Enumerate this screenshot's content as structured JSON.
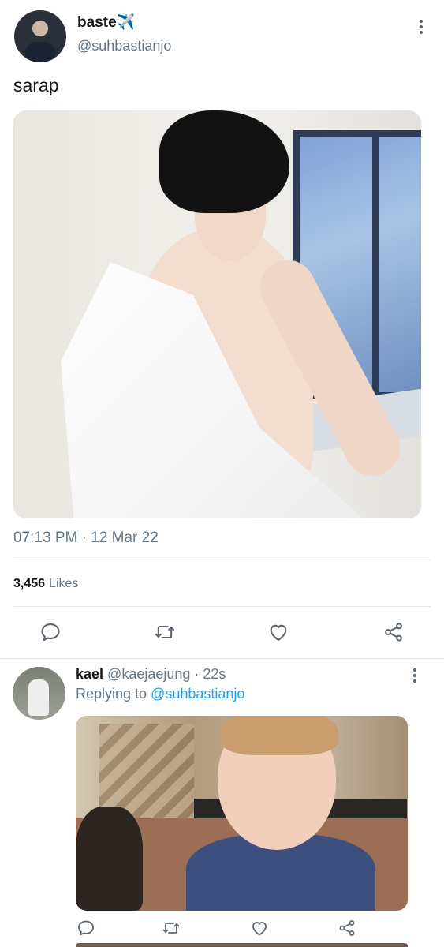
{
  "main_tweet": {
    "display_name": "baste✈️",
    "handle": "@suhbastianjo",
    "text": "sarap",
    "timestamp": "07:13 PM · 12 Mar 22",
    "likes_count": "3,456",
    "likes_label": "Likes"
  },
  "reply_tweet": {
    "display_name": "kael",
    "handle_time": "@kaejaejung · 22s",
    "replying_prefix": "Replying to ",
    "replying_to": "@suhbastianjo"
  },
  "colors": {
    "text_primary": "#14171a",
    "text_secondary": "#657786",
    "link": "#1da1f2",
    "divider": "#e1e8ed"
  },
  "icons": {
    "reply": "reply-icon",
    "retweet": "retweet-icon",
    "like": "heart-icon",
    "share": "share-icon",
    "more": "more-options-icon"
  }
}
